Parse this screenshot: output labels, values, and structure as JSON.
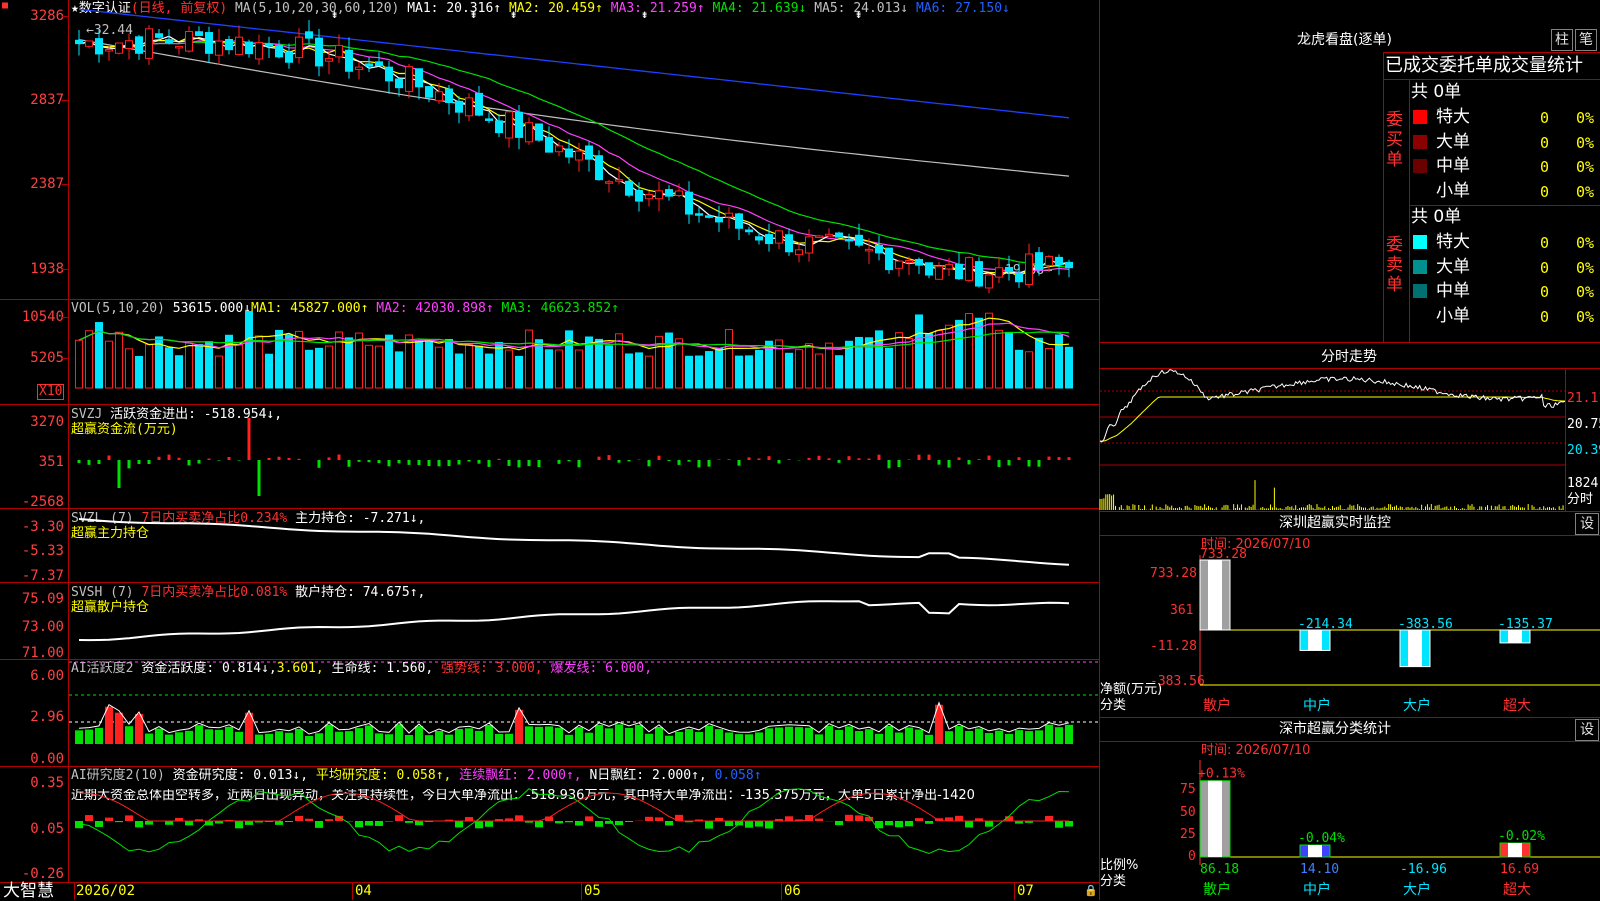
{
  "status_bar": {
    "app_name": "大智慧",
    "dates": [
      "2026/02",
      "04",
      "05",
      "06",
      "07"
    ]
  },
  "main_chart": {
    "title_star": "★",
    "stock_name": "数字认证",
    "period": "(日线, 前复权)",
    "ma_label": "MA(5,10,20,30,60,120)",
    "ma1": "MA1: 20.316↑",
    "ma2": "MA2: 20.459↑",
    "ma3": "MA3: 21.259↑",
    "ma4": "MA4: 21.639↓",
    "ma5": "MA5: 24.013↓",
    "ma6": "MA6: 27.150↓",
    "price_axis": [
      "3286",
      "2837",
      "2387",
      "1938"
    ],
    "high_label": "32.44",
    "low_label": "19.38",
    "colors": {
      "up": "#ff2020",
      "down": "#00e5ff",
      "ma1": "#ffffff",
      "ma2": "#ffff00",
      "ma3": "#ff40ff",
      "ma4": "#00e000",
      "ma5": "#c0c0c0",
      "ma6": "#2040ff"
    }
  },
  "vol_panel": {
    "label": "VOL(5,10,20)",
    "value": "53615.000↓",
    "ma1": "MA1: 45827.000↑",
    "ma2": "MA2: 42030.898↑",
    "ma3": "MA3: 46623.852↑",
    "axis": [
      "10540",
      "5205"
    ],
    "unit": "X10"
  },
  "svzj_panel": {
    "label": "SVZJ",
    "value": "活跃资金进出: -518.954↓,",
    "sub": "超赢资金流(万元)",
    "axis": [
      "3270",
      "351",
      "-2568"
    ]
  },
  "svzl_panel": {
    "label": "SVZL (7)",
    "desc": "7日内买卖净占比0.234%",
    "value": "主力持仓: -7.271↓,",
    "sub": "超赢主力持仓",
    "axis": [
      "-3.30",
      "-5.33",
      "-7.37"
    ]
  },
  "svsh_panel": {
    "label": "SVSH (7)",
    "desc": "7日内买卖净占比0.081%",
    "value": "散户持仓: 74.675↑,",
    "sub": "超赢散户持仓",
    "axis": [
      "75.09",
      "73.00",
      "71.00"
    ]
  },
  "ai_active": {
    "label": "AI活跃度2",
    "v1": "资金活跃度: 0.814↓,",
    "v2": "3.601,",
    "v3": "生命线: 1.560,",
    "v4": "强势线: 3.000,",
    "v5": "爆发线: 6.000,",
    "axis": [
      "6.00",
      "2.96",
      "0.00"
    ]
  },
  "ai_research": {
    "label": "AI研究度2(10)",
    "v1": "资金研究度: 0.013↓,",
    "v2": "平均研究度: 0.058↑,",
    "v3": "连续飘红: 2.000↑,",
    "v4": "N日飘红: 2.000↑,",
    "v5": "0.058↑",
    "commentary": "近期大资金总体由空转多，近两日出现异动，关注其持续性，今日大单净流出：-518.936万元，其中特大单净流出：-135.375万元，大单5日累计净出-1420",
    "axis": [
      "0.35",
      "0.05",
      "-0.26"
    ]
  },
  "dragon_tiger": {
    "title": "龙虎看盘(逐单)",
    "btn_bar": "柱",
    "btn_pen": "笔",
    "tabs": "已成交委托单成交量统计",
    "buy_side": "委买单",
    "sell_side": "委卖单",
    "buy_total": "共 0单",
    "sell_total": "共 0单",
    "buy_rows": [
      {
        "name": "特大",
        "count": "0",
        "pct": "0%",
        "color": "#ff0000"
      },
      {
        "name": "大单",
        "count": "0",
        "pct": "0%",
        "color": "#8b0000"
      },
      {
        "name": "中单",
        "count": "0",
        "pct": "0%",
        "color": "#6a0000"
      },
      {
        "name": "小单",
        "count": "0",
        "pct": "0%",
        "color": "#000000"
      }
    ],
    "sell_rows": [
      {
        "name": "特大",
        "count": "0",
        "pct": "0%",
        "color": "#00ffff"
      },
      {
        "name": "大单",
        "count": "0",
        "pct": "0%",
        "color": "#009090"
      },
      {
        "name": "中单",
        "count": "0",
        "pct": "0%",
        "color": "#007070"
      },
      {
        "name": "小单",
        "count": "0",
        "pct": "0%",
        "color": "#000000"
      }
    ]
  },
  "intraday": {
    "title": "分时走势",
    "axis": [
      "21.11",
      "20.75",
      "20.39"
    ],
    "vol_axis": [
      "1824",
      "分时"
    ]
  },
  "sz_monitor": {
    "title": "深圳超赢实时监控",
    "btn": "设",
    "time": "时间: 2026/07/10",
    "axis": [
      "733.28",
      "361",
      "-11.28",
      "-383.56"
    ],
    "y_label": "净额(万元)",
    "x_label": "分类",
    "categories": [
      "散户",
      "中户",
      "大户",
      "超大"
    ],
    "values": [
      "733.28",
      "-214.34",
      "-383.56",
      "-135.37"
    ],
    "chart_data": {
      "type": "bar",
      "categories": [
        "散户",
        "中户",
        "大户",
        "超大"
      ],
      "values": [
        733.28,
        -214.34,
        -383.56,
        -135.37
      ],
      "ylim": [
        -383.56,
        733.28
      ]
    }
  },
  "sz_class": {
    "title": "深市超赢分类统计",
    "btn": "设",
    "time": "时间: 2026/07/10",
    "axis": [
      "75",
      "50",
      "25",
      "0"
    ],
    "y_label": "比例%",
    "x_label": "分类",
    "categories": [
      "散户",
      "中户",
      "大户",
      "超大"
    ],
    "values": [
      "86.18",
      "14.10",
      "-16.96",
      "16.69"
    ],
    "bar_labels": [
      "+0.13%",
      "-0.04%",
      "",
      "-0.02%"
    ],
    "chart_data": {
      "type": "bar",
      "categories": [
        "散户",
        "中户",
        "大户",
        "超大"
      ],
      "values": [
        86.18,
        14.1,
        -16.96,
        16.69
      ],
      "ylim": [
        0,
        75
      ]
    }
  }
}
